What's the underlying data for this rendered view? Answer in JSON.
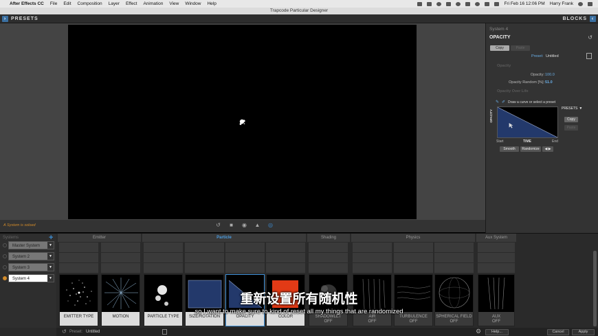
{
  "menubar": {
    "app": "After Effects CC",
    "items": [
      "File",
      "Edit",
      "Composition",
      "Layer",
      "Effect",
      "Animation",
      "View",
      "Window",
      "Help"
    ],
    "clock": "Fri Feb 16 12:06 PM",
    "user": "Harry Frank"
  },
  "window": {
    "title": "Trapcode Particular Designer"
  },
  "topbar": {
    "presets_label": "PRESETS",
    "blocks_label": "BLOCKS"
  },
  "status": {
    "message": "A System is soloed"
  },
  "props": {
    "system": "System 4",
    "title": "OPACITY",
    "copy_label": "Copy",
    "paste_label": "Paste",
    "preset_label": "Preset:",
    "preset_value": "Untitled",
    "section_opacity": "Opacity",
    "opacity_label": "Opacity:",
    "opacity_value": "100.0",
    "opacity_random_label": "Opacity Random [%]:",
    "opacity_random_value": "51.0",
    "section_over_life": "Opacity Over Life",
    "curve_hint": "Draw a curve or select a preset",
    "graph_ylabel": "OPACITY",
    "graph_start": "Start",
    "graph_time": "TIME",
    "graph_end": "End",
    "presets_dd": "PRESETS",
    "graph_copy": "Copy",
    "graph_paste": "Paste",
    "smooth": "Smooth",
    "randomize": "Randomize",
    "flip": "◀ ▶"
  },
  "systems": {
    "header": "Systems",
    "items": [
      "Master System",
      "System 2",
      "System 3",
      "System 4"
    ],
    "selected": "System 4"
  },
  "categories": [
    "Emitter",
    "Particle",
    "Shading",
    "Physics",
    "Aux System"
  ],
  "active_category": "Particle",
  "tiles": [
    {
      "label": "EMITTER TYPE",
      "sub": ""
    },
    {
      "label": "MOTION",
      "sub": ""
    },
    {
      "label": "PARTICLE TYPE",
      "sub": ""
    },
    {
      "label": "SIZE/ROTATION",
      "sub": ""
    },
    {
      "label": "OPACITY",
      "sub": ""
    },
    {
      "label": "COLOR",
      "sub": ""
    },
    {
      "label": "SHADOWLET",
      "sub": "OFF"
    },
    {
      "label": "AIR",
      "sub": "OFF"
    },
    {
      "label": "TURBULENCE",
      "sub": "OFF"
    },
    {
      "label": "SPHERICAL FIELD",
      "sub": "OFF"
    },
    {
      "label": "AUX",
      "sub": "OFF"
    }
  ],
  "bottombar": {
    "preset_label": "Preset:",
    "preset_value": "Untitled",
    "help": "Help...",
    "cancel": "Cancel",
    "apply": "Apply"
  },
  "subtitles": {
    "zh": "重新设置所有随机性",
    "en": "so I want to make sure to kind of reset all my things that are randomized"
  }
}
